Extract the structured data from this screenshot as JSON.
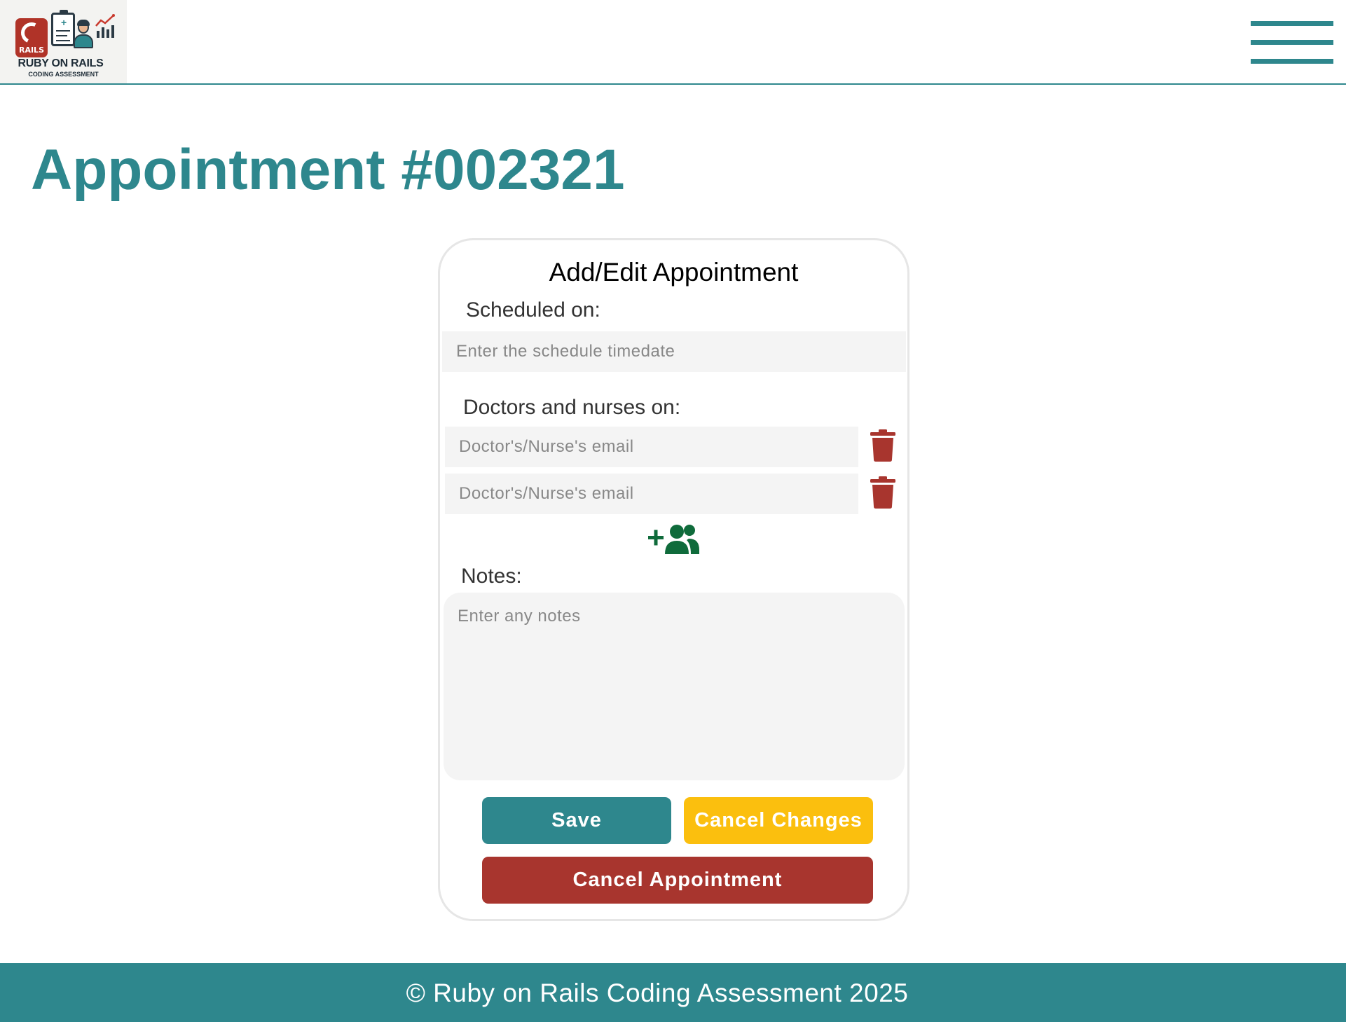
{
  "header": {
    "logo": {
      "badge": "RAILS",
      "title": "RUBY ON RAILS",
      "subtitle": "CODING ASSESSMENT"
    },
    "menu_icon": "hamburger-menu-icon"
  },
  "page": {
    "title": "Appointment #002321"
  },
  "form": {
    "title": "Add/Edit Appointment",
    "scheduled_label": "Scheduled on:",
    "scheduled_placeholder": "Enter the schedule timedate",
    "staff_label": "Doctors and nurses on:",
    "staff_entries": [
      {
        "placeholder": "Doctor's/Nurse's email"
      },
      {
        "placeholder": "Doctor's/Nurse's email"
      }
    ],
    "notes_label": "Notes:",
    "notes_placeholder": "Enter any notes",
    "buttons": {
      "save": "Save",
      "cancel_changes": "Cancel Changes",
      "cancel_appointment": "Cancel Appointment"
    },
    "colors": {
      "primary": "#2e878d",
      "warning": "#fbbf0e",
      "danger": "#a8352e",
      "add_icon": "#0f6b3b"
    }
  },
  "footer": {
    "text": "© Ruby on Rails Coding Assessment 2025"
  }
}
